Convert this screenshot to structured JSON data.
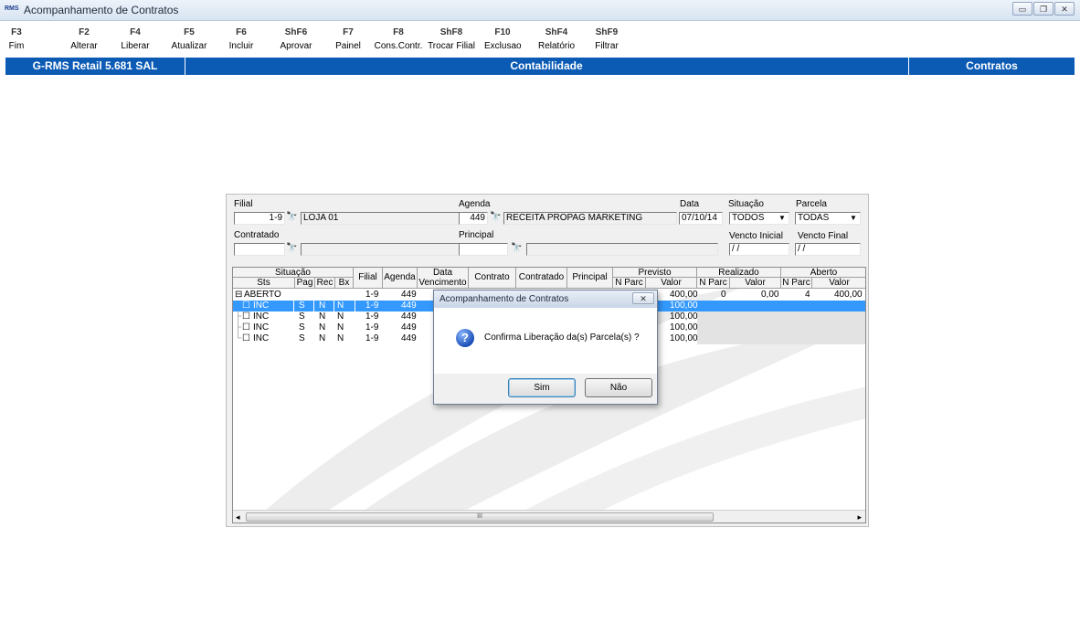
{
  "window": {
    "logo": "RMS",
    "title": "Acompanhamento de Contratos",
    "controls": [
      "▭",
      "❐",
      "✕"
    ]
  },
  "toolbar": [
    {
      "key": "F3",
      "label": "Fim"
    },
    {
      "key": "F2",
      "label": "Alterar"
    },
    {
      "key": "F4",
      "label": "Liberar"
    },
    {
      "key": "F5",
      "label": "Atualizar"
    },
    {
      "key": "F6",
      "label": "Incluir"
    },
    {
      "key": "ShF6",
      "label": "Aprovar"
    },
    {
      "key": "F7",
      "label": "Painel"
    },
    {
      "key": "F8",
      "label": "Cons.Contr."
    },
    {
      "key": "ShF8",
      "label": "Trocar Filial"
    },
    {
      "key": "F10",
      "label": "Exclusao"
    },
    {
      "key": "ShF4",
      "label": "Relatório"
    },
    {
      "key": "ShF9",
      "label": "Filtrar"
    }
  ],
  "statusbar": {
    "left": "G-RMS Retail 5.681 SAL",
    "center": "Contabilidade",
    "right": "Contratos",
    "color": "#0b5bb5"
  },
  "form": {
    "filial_label": "Filial",
    "filial_code": "1-9",
    "filial_name": "LOJA 01",
    "agenda_label": "Agenda",
    "agenda_code": "449",
    "agenda_name": "RECEITA PROPAG MARKETING",
    "data_label": "Data",
    "data_value": "07/10/14",
    "situacao_label": "Situação",
    "situacao_value": "TODOS",
    "parcela_label": "Parcela",
    "parcela_value": "TODAS",
    "contratado_label": "Contratado",
    "contratado_code": "",
    "contratado_name": "",
    "principal_label": "Principal",
    "principal_code": "",
    "principal_name": "",
    "vencto_inicial_label": "Vencto Inicial",
    "vencto_inicial_value": "/ /",
    "vencto_final_label": "Vencto Final",
    "vencto_final_value": "/ /"
  },
  "grid": {
    "groups": {
      "situacao": "Situação",
      "previsto": "Previsto",
      "realizado": "Realizado",
      "aberto": "Aberto"
    },
    "columns": {
      "sts": "Sts",
      "pag": "Pag",
      "rec": "Rec",
      "bx": "Bx",
      "filial": "Filial",
      "agenda": "Agenda",
      "data": "Data",
      "vencimento": "Vencimento",
      "contrato": "Contrato",
      "contratado": "Contratado",
      "principal": "Principal",
      "nparc": "N Parc",
      "valor": "Valor"
    },
    "group_row": {
      "label": "ABERTO",
      "filial": "1-9",
      "agenda": "449",
      "prev_valor": "400,00",
      "real_nparc": "0",
      "real_valor": "0,00",
      "aberto_nparc": "4",
      "aberto_valor": "400,00"
    },
    "rows": [
      {
        "sts": "INC",
        "pag": "S",
        "rec": "N",
        "bx": "N",
        "filial": "1-9",
        "agenda": "449",
        "prev_valor": "100,00"
      },
      {
        "sts": "INC",
        "pag": "S",
        "rec": "N",
        "bx": "N",
        "filial": "1-9",
        "agenda": "449",
        "prev_valor": "100,00"
      },
      {
        "sts": "INC",
        "pag": "S",
        "rec": "N",
        "bx": "N",
        "filial": "1-9",
        "agenda": "449",
        "prev_valor": "100,00"
      },
      {
        "sts": "INC",
        "pag": "S",
        "rec": "N",
        "bx": "N",
        "filial": "1-9",
        "agenda": "449",
        "prev_valor": "100,00"
      }
    ],
    "scroll_thumb_label": "III"
  },
  "dialog": {
    "title": "Acompanhamento de Contratos",
    "message": "Confirma Liberação da(s) Parcela(s) ?",
    "yes": "Sim",
    "no": "Não",
    "close": "✕"
  }
}
